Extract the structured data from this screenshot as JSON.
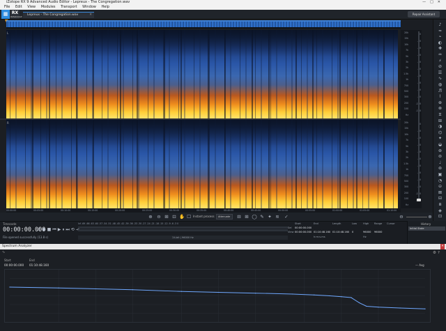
{
  "window": {
    "title": "iZotope RX 9 Advanced Audio Editor - Lepreux - The Congregation.wav",
    "controls": [
      "—",
      "□",
      "✕"
    ]
  },
  "menu": [
    "File",
    "Edit",
    "View",
    "Modules",
    "Transport",
    "Window",
    "Help"
  ],
  "toolbar": {
    "logo_rx": "RX",
    "logo_sub": "Advanced",
    "file_tab": "Lepreux - The Congregation.wav",
    "file_tab_close": "✕",
    "repair_assistant": "Repair Assistant"
  },
  "spectrogram": {
    "channel_labels": [
      "L",
      "R"
    ],
    "freq_ticks": [
      "20k",
      "15k",
      "10k",
      "7k",
      "5k",
      "3k",
      "2k",
      "1.5k",
      "1k",
      "700",
      "500",
      "300",
      "200",
      "100",
      "Hz"
    ],
    "db_ticks": [
      "0",
      "-10",
      "-20",
      "-30",
      "-40",
      "-50",
      "-60",
      "-70",
      "-80",
      "-90",
      "-100",
      "-110"
    ],
    "time_ticks": [
      "00:00:00",
      "00:05:00",
      "00:10:00",
      "00:15:00",
      "00:20:00",
      "00:25:00",
      "00:30:00",
      "00:35:00",
      "00:40:00",
      "00:45:00",
      "00:50:00",
      "00:55:00",
      "01:00:00",
      "01:05:00",
      "01:10:00"
    ]
  },
  "viewtools": {
    "instant_process_label": "Instant process",
    "instant_process_value": "Attenuate"
  },
  "transport": {
    "timecode_label": "Timecode",
    "timecode": "00:00:00.000",
    "status": "File opened successfully (13.8 s)",
    "meter_scale": "Inf  -69  -66  -63  -60  -57  -54  -51  -48  -45  -42  -39  -36  -33  -30  -27  -24  -21  -18  -15  -12  -9  -6  -3  0",
    "bitrate": "24-bit | 96000 Hz",
    "sel_headers": {
      "start": "Start",
      "end": "End",
      "length": "Length",
      "low": "Low",
      "high": "High",
      "range": "Range",
      "cursor": "Cursor"
    },
    "sel_label": "Sel",
    "view_label": "View",
    "sel_start": "00:00:00.000",
    "view_start": "00:00:00.000",
    "view_end": "01:10:48.160",
    "view_length": "01:10:48.160",
    "low": "0",
    "high": "96000",
    "range": "96000",
    "format": "h:m:s.ms",
    "hz": "Hz"
  },
  "history": {
    "title": "History",
    "item": "Initial State"
  },
  "spectrum_analyzer": {
    "title": "Spectrum Analyzer",
    "close": "✕",
    "start_label": "Start",
    "start_value": "00:00:00.000",
    "end_label": "End",
    "end_value": "01:10:48.160",
    "legend": "Avg"
  },
  "chart_data": {
    "type": "line",
    "title": "",
    "xlabel": "",
    "ylabel": "",
    "x_scale": "log",
    "x": [
      20,
      50,
      100,
      200,
      500,
      1000,
      2000,
      4000,
      6000,
      8000,
      10000,
      12000,
      14000,
      16000,
      20000,
      30000,
      48000
    ],
    "y": [
      -20,
      -21,
      -22,
      -23,
      -25,
      -26,
      -27,
      -28,
      -29,
      -30,
      -31,
      -32,
      -38,
      -42,
      -43,
      -44,
      -45
    ],
    "xlim": [
      20,
      48000
    ],
    "ylim": [
      -60,
      0
    ],
    "colors": {
      "line": "#6fa8ff"
    }
  },
  "colors": {
    "accent": "#2e8de0",
    "spectrogram_hot": "#ffcf3a",
    "spectrogram_cold": "#1c3a78"
  }
}
